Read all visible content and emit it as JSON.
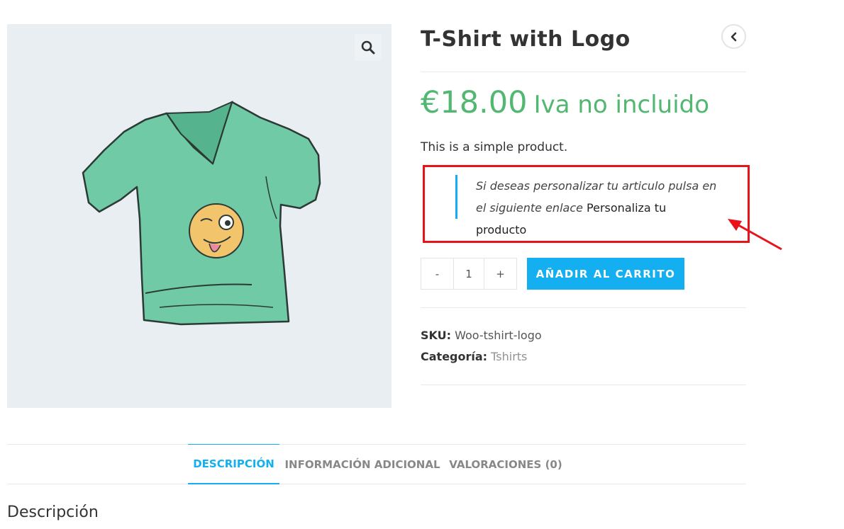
{
  "product": {
    "title": "T-Shirt with Logo",
    "price": "€18.00",
    "price_suffix": "Iva no incluido",
    "short_description": "This is a simple product."
  },
  "customize_note": {
    "text": "Si deseas personalizar tu articulo pulsa en el siguiente enlace ",
    "link": "Personaliza tu producto"
  },
  "quantity": {
    "minus": "-",
    "value": "1",
    "plus": "+"
  },
  "cart_button": "AÑADIR AL CARRITO",
  "meta": {
    "sku_label": "SKU:",
    "sku_value": "Woo-tshirt-logo",
    "category_label": "Categoría:",
    "category_value": "Tshirts"
  },
  "tabs": [
    {
      "label": "DESCRIPCIÓN",
      "active": true
    },
    {
      "label": "INFORMACIÓN ADICIONAL",
      "active": false
    },
    {
      "label": "VALORACIONES (0)",
      "active": false
    }
  ],
  "description_heading": "Descripción",
  "icons": {
    "zoom": "search-icon",
    "nav": "chevron-left-icon"
  },
  "colors": {
    "accent": "#13aff0",
    "price": "#52b770",
    "highlight_box": "#e8121a",
    "arrow": "#e8121a"
  }
}
